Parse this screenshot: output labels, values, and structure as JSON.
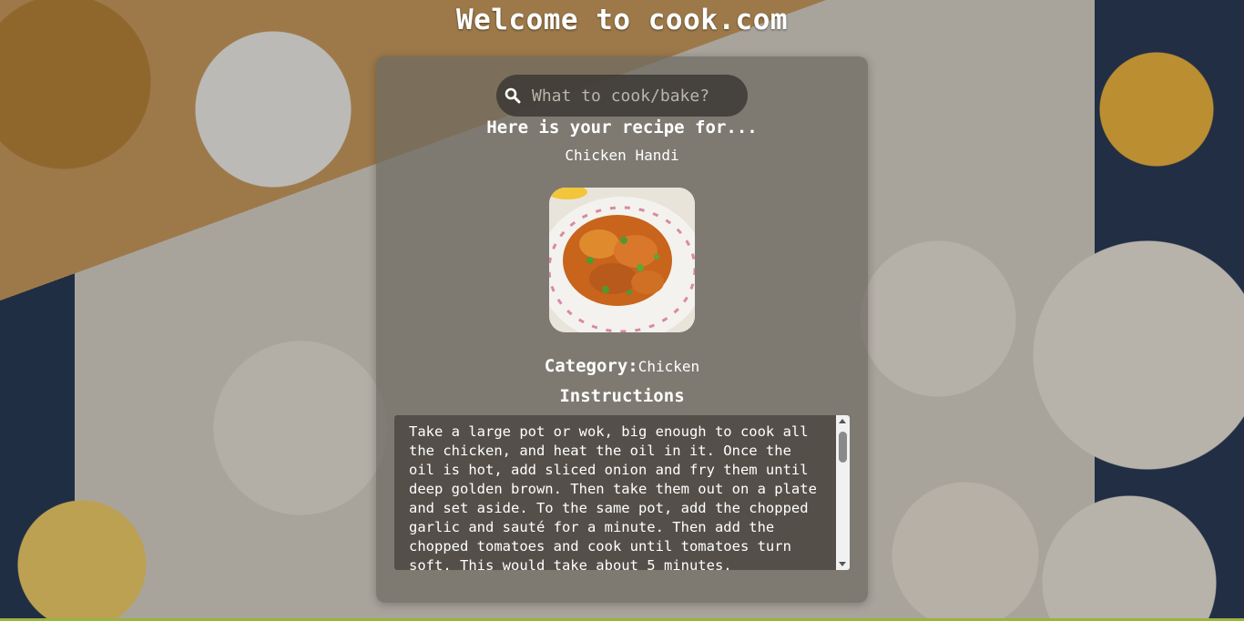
{
  "page": {
    "title": "Welcome to cook.com"
  },
  "search": {
    "placeholder": "What to cook/bake?",
    "value": ""
  },
  "recipe": {
    "heading": "Here is your recipe for...",
    "name": "Chicken Handi",
    "category_label": "Category:",
    "category_value": "Chicken",
    "instructions_heading": "Instructions",
    "instructions": "Take a large pot or wok, big enough to cook all the chicken, and heat the oil in it. Once the oil is hot, add sliced onion and fry them until deep golden brown. Then take them out on a plate and set aside. To the same pot, add the chopped garlic and sauté for a minute. Then add the chopped tomatoes and cook until tomatoes turn soft. This would take about 5 minutes."
  },
  "colors": {
    "accent_strip": "#9ab43c",
    "card_bg": "rgba(110,105,98,0.72)"
  },
  "icons": {
    "search": "magnifying-glass"
  }
}
